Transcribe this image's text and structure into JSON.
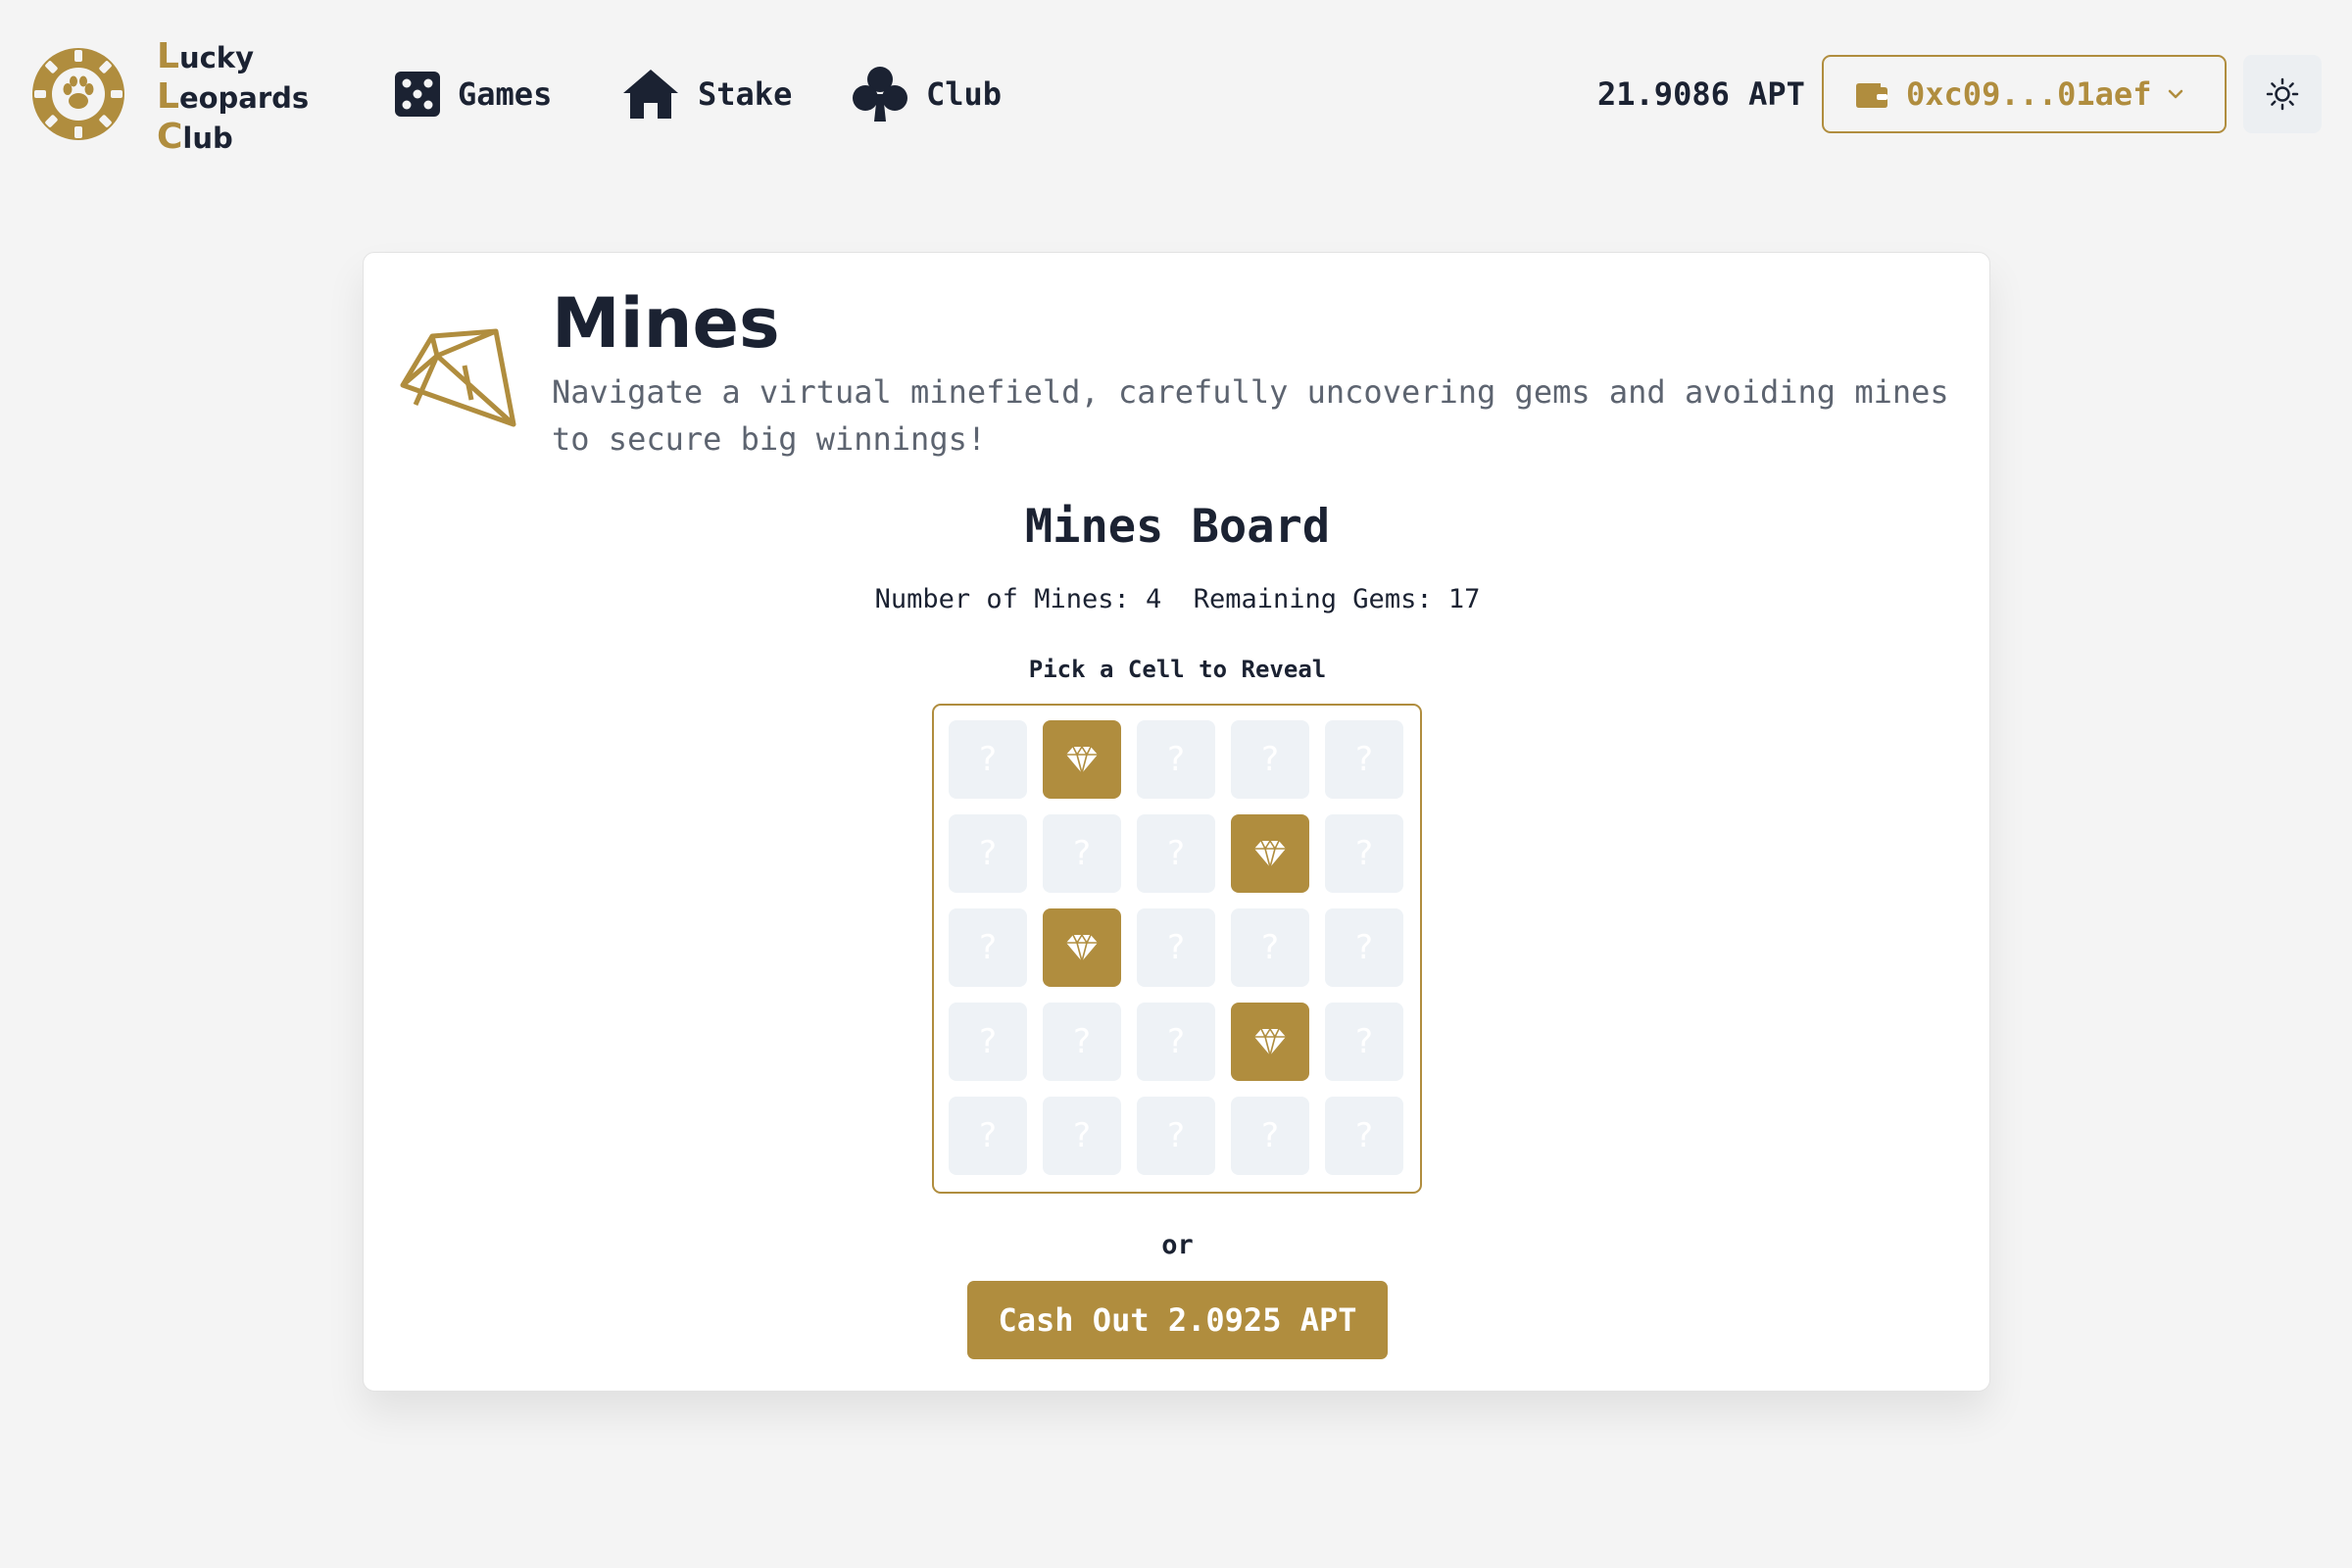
{
  "brand": {
    "lines": [
      {
        "initial": "L",
        "rest": "ucky"
      },
      {
        "initial": "L",
        "rest": "eopards"
      },
      {
        "initial": "C",
        "rest": "lub"
      }
    ]
  },
  "nav": {
    "games_label": "Games",
    "stake_label": "Stake",
    "club_label": "Club"
  },
  "account": {
    "balance": "21.9086 APT",
    "wallet_address": "0xc09...01aef"
  },
  "game": {
    "title": "Mines",
    "description": "Navigate a virtual minefield, carefully uncovering gems and avoiding mines to secure big winnings!",
    "board_title": "Mines Board",
    "stats_text": "Number of Mines: 4  Remaining Gems: 17",
    "pick_prompt": "Pick a Cell to Reveal",
    "hidden_cell_symbol": "?",
    "or_text": "or",
    "cashout_label": "Cash Out 2.0925 APT",
    "grid": [
      [
        "hidden",
        "gem",
        "hidden",
        "hidden",
        "hidden"
      ],
      [
        "hidden",
        "hidden",
        "hidden",
        "gem",
        "hidden"
      ],
      [
        "hidden",
        "gem",
        "hidden",
        "hidden",
        "hidden"
      ],
      [
        "hidden",
        "hidden",
        "hidden",
        "gem",
        "hidden"
      ],
      [
        "hidden",
        "hidden",
        "hidden",
        "hidden",
        "hidden"
      ]
    ]
  },
  "colors": {
    "accent": "#b08d3e",
    "text": "#1b2232",
    "muted_text": "#5d6470",
    "background": "#f4f4f4",
    "hidden_cell": "#eef2f6"
  }
}
